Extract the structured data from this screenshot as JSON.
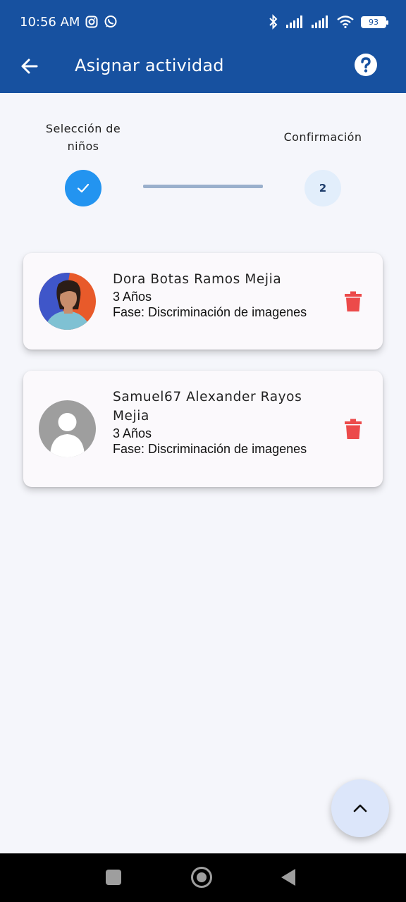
{
  "status_bar": {
    "time": "10:56 AM",
    "battery": "93",
    "left_icons": [
      "instagram-icon",
      "whatsapp-icon"
    ],
    "right_icons": [
      "bluetooth-icon",
      "signal-icon",
      "signal-icon",
      "wifi-icon",
      "battery-icon"
    ]
  },
  "appbar": {
    "title": "Asignar actividad",
    "back_icon": "arrow-left-icon",
    "help_icon": "help-circle-icon",
    "color": "#1751a0"
  },
  "stepper": {
    "steps": [
      {
        "label": "Selección de niños",
        "state": "done",
        "icon": "check-icon"
      },
      {
        "label": "Confirmación",
        "number": "2",
        "state": "pending"
      }
    ],
    "done_color": "#2394f0",
    "pending_color": "#e2eefb"
  },
  "children": [
    {
      "name": "Dora Botas Ramos Mejia",
      "age": "3 Años",
      "phase": "Fase: Discriminación de imagenes",
      "avatar": "photo"
    },
    {
      "name": "Samuel67 Alexander Rayos Mejia",
      "age": "3 Años",
      "phase": "Fase: Discriminación de imagenes",
      "avatar": "placeholder-person-icon"
    }
  ],
  "delete_icon": "trash-icon",
  "delete_color": "#ec4a4a",
  "fab_icon": "chevron-up-icon",
  "nav_bar": [
    "square-icon",
    "home-circle-icon",
    "back-triangle-icon"
  ]
}
